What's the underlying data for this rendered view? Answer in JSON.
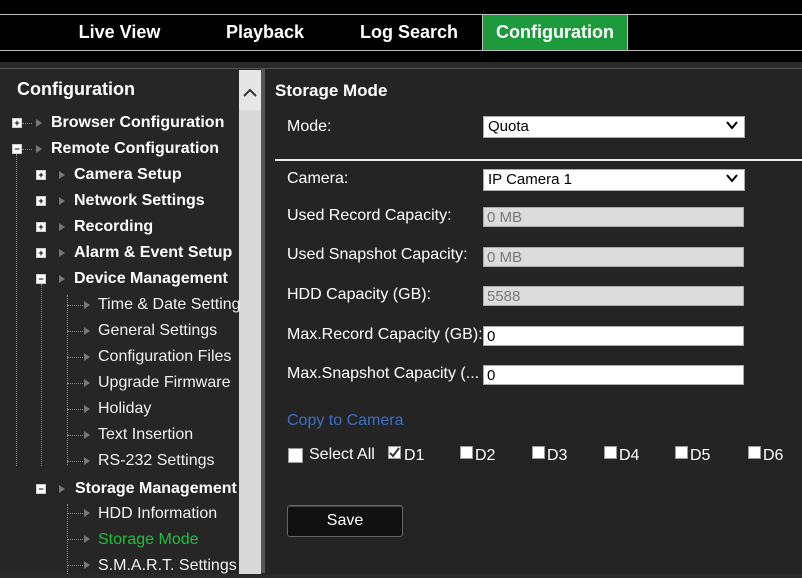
{
  "nav": {
    "tabs": [
      {
        "label": "Live View"
      },
      {
        "label": "Playback"
      },
      {
        "label": "Log Search"
      },
      {
        "label": "Configuration",
        "active": true
      }
    ]
  },
  "sidebar": {
    "title": "Configuration",
    "items": [
      {
        "label": "Browser Configuration"
      },
      {
        "label": "Remote Configuration"
      },
      {
        "label": "Camera Setup"
      },
      {
        "label": "Network Settings"
      },
      {
        "label": "Recording"
      },
      {
        "label": "Alarm & Event Setup"
      },
      {
        "label": "Device Management"
      },
      {
        "label": "Time & Date Setting"
      },
      {
        "label": "General Settings"
      },
      {
        "label": "Configuration Files"
      },
      {
        "label": "Upgrade Firmware"
      },
      {
        "label": "Holiday"
      },
      {
        "label": "Text Insertion"
      },
      {
        "label": "RS-232 Settings"
      },
      {
        "label": "Storage Management"
      },
      {
        "label": "HDD Information"
      },
      {
        "label": "Storage Mode",
        "selected": true
      },
      {
        "label": "S.M.A.R.T. Settings"
      }
    ]
  },
  "main": {
    "title": "Storage Mode",
    "mode": {
      "label": "Mode:",
      "value": "Quota"
    },
    "camera": {
      "label": "Camera:",
      "value": "IP Camera 1"
    },
    "used_record": {
      "label": "Used Record Capacity:",
      "value": "0 MB"
    },
    "used_snapshot": {
      "label": "Used Snapshot Capacity:",
      "value": "0 MB"
    },
    "hdd_capacity": {
      "label": "HDD Capacity (GB):",
      "value": "5588"
    },
    "max_record": {
      "label": "Max.Record Capacity (GB):",
      "value": "0"
    },
    "max_snapshot": {
      "label": "Max.Snapshot Capacity (...",
      "value": "0"
    },
    "copy_to_camera": "Copy to Camera",
    "select_all": "Select All",
    "cameras": [
      {
        "label": "D1",
        "checked": true
      },
      {
        "label": "D2",
        "checked": false
      },
      {
        "label": "D3",
        "checked": false
      },
      {
        "label": "D4",
        "checked": false
      },
      {
        "label": "D5",
        "checked": false
      },
      {
        "label": "D6",
        "checked": false
      }
    ],
    "save_label": "Save"
  },
  "colors": {
    "accent": "#1c9a3c",
    "link": "#3a6fc4",
    "selected_item": "#1fbf3f"
  },
  "icons": {
    "expand": "plus-box-icon",
    "collapse": "minus-box-icon",
    "node": "triangle-right-icon",
    "dropdown": "chevron-down-icon",
    "scroll": "chevron-up-icon"
  }
}
